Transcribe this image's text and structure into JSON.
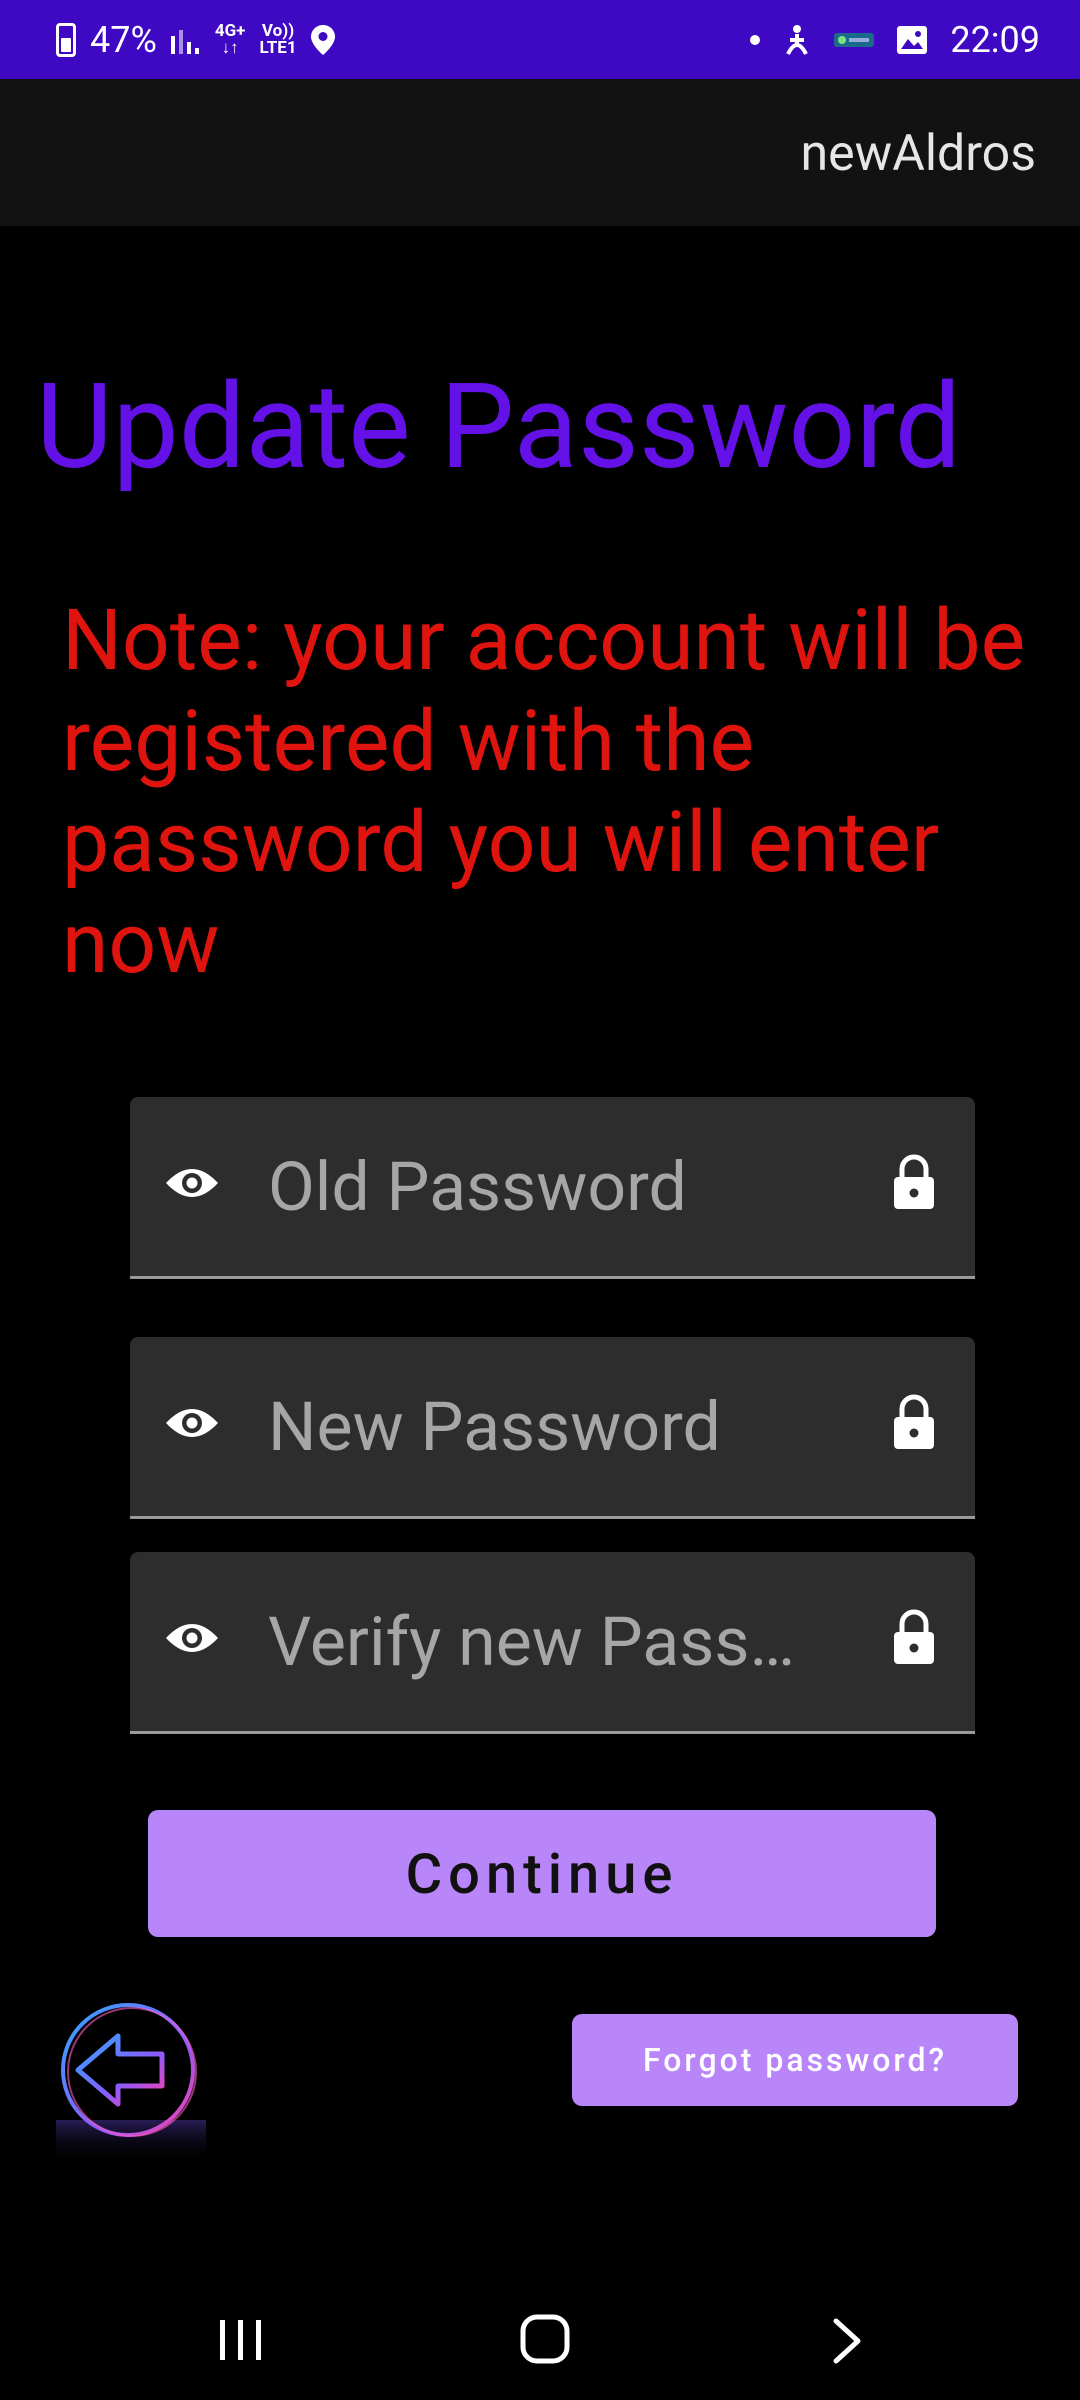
{
  "status_bar": {
    "battery": "47%",
    "network_top": "4G+",
    "network_bottom": "LTE1",
    "volte_top": "Vo))",
    "time": "22:09"
  },
  "app_bar": {
    "title": "newAldros"
  },
  "page": {
    "title": "Update Password",
    "note": "Note: your account will be registered with the password you will enter now"
  },
  "fields": {
    "old_password": {
      "placeholder": "Old Password",
      "value": ""
    },
    "new_password": {
      "placeholder": "New Password",
      "value": ""
    },
    "verify_password": {
      "placeholder": "Verify new Pass…",
      "value": ""
    }
  },
  "buttons": {
    "continue": "Continue",
    "forgot": "Forgot password?"
  },
  "colors": {
    "status_bar": "#3f08c3",
    "title": "#6411e8",
    "note": "#e0140f",
    "button": "#b886f8",
    "field_bg": "#2d2d2d"
  },
  "icons": {
    "field_left": "eye-icon",
    "field_right": "lock-icon",
    "back": "arrow-left-icon",
    "nav": [
      "recents-icon",
      "home-icon",
      "back-icon"
    ]
  }
}
